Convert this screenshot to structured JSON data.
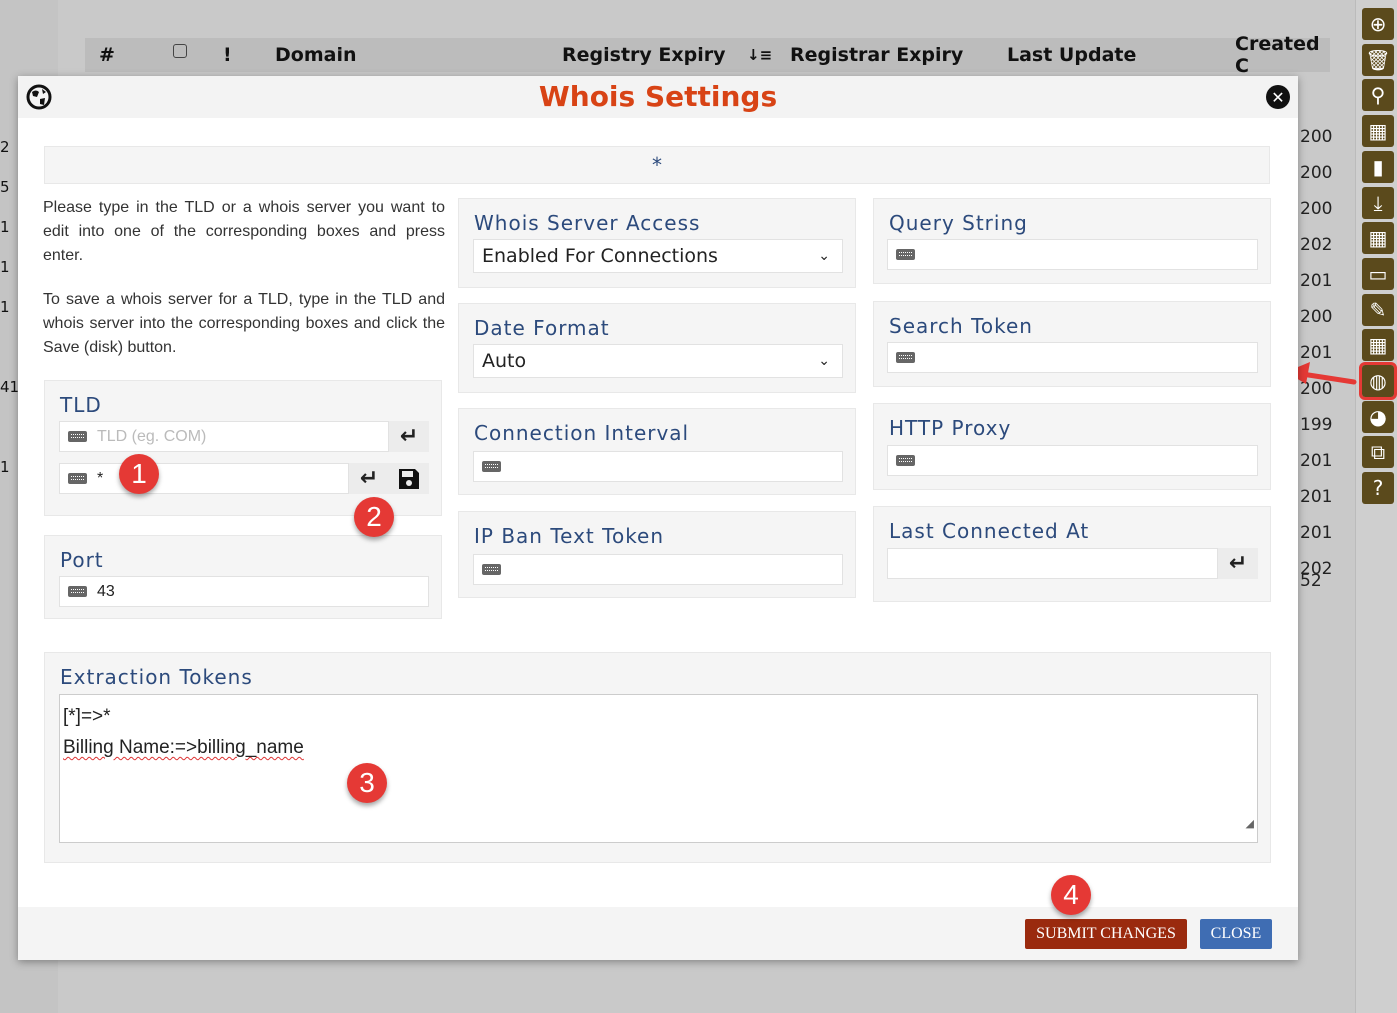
{
  "background_table": {
    "headers": [
      "#",
      "!",
      "Domain",
      "Registry Expiry",
      "Registrar Expiry",
      "Last Update",
      "Created C"
    ],
    "left_numbers": [
      "2",
      "5",
      "1",
      "1",
      "1",
      "41",
      "1"
    ],
    "right_numbers": [
      "200",
      "200",
      "200",
      "202",
      "201",
      "200",
      "201",
      "200",
      "199",
      "201",
      "201",
      "201",
      "202",
      "52"
    ]
  },
  "sidebar": {
    "icons": [
      "plus-circle",
      "trash",
      "search",
      "grid-search",
      "bookmark",
      "download",
      "grid-add",
      "folder-check",
      "pencil",
      "grid-settings",
      "globe",
      "palette",
      "external-link",
      "question"
    ],
    "active": "globe",
    "icon_color": "#5b4a1c"
  },
  "modal": {
    "title": "Whois Settings",
    "title_color": "#d84315",
    "selected_tld": "*",
    "help_text_1": "Please type in the TLD or a whois server you want to edit into one of the corresponding boxes and press enter.",
    "help_text_2": "To save a whois server for a TLD, type in the TLD and whois server into the corresponding boxes and click the Save (disk) button.",
    "tld": {
      "label": "TLD",
      "placeholder": "TLD (eg. COM)",
      "server_value": "*"
    },
    "port": {
      "label": "Port",
      "value": "43"
    },
    "whois_server_access": {
      "label": "Whois Server Access",
      "value": "Enabled For Connections"
    },
    "date_format": {
      "label": "Date Format",
      "value": "Auto"
    },
    "connection_interval": {
      "label": "Connection Interval",
      "value": ""
    },
    "ip_ban_text_token": {
      "label": "IP Ban Text Token",
      "value": ""
    },
    "query_string": {
      "label": "Query String",
      "value": ""
    },
    "search_token": {
      "label": "Search Token",
      "value": ""
    },
    "http_proxy": {
      "label": "HTTP Proxy",
      "value": ""
    },
    "last_connected_at": {
      "label": "Last Connected At",
      "value": ""
    },
    "extraction_tokens": {
      "label": "Extraction Tokens",
      "line1": "[*]=>*",
      "line2": "Billing Name:=>billing_name"
    },
    "submit_label": "SUBMIT CHANGES",
    "close_label": "CLOSE",
    "submit_color": "#9a2a0e",
    "close_color": "#3f6db3"
  },
  "annotations": [
    "1",
    "2",
    "3",
    "4"
  ]
}
